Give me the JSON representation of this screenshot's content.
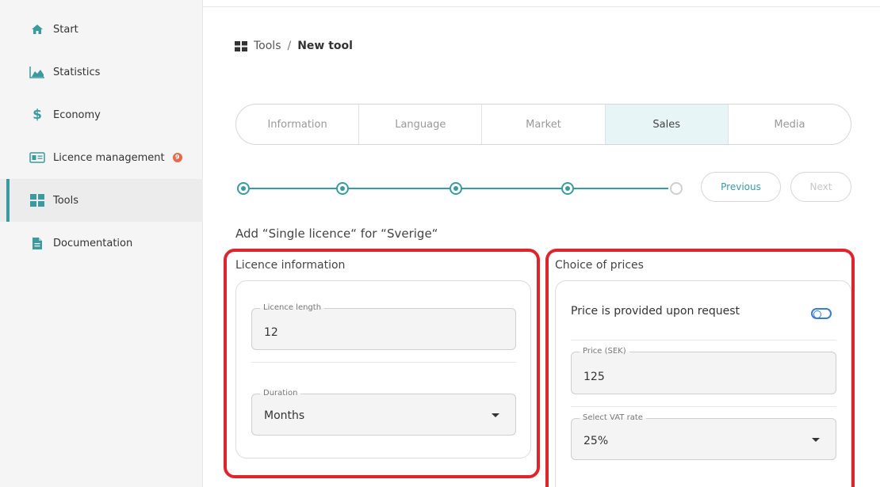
{
  "sidebar": {
    "items": [
      {
        "label": "Start",
        "icon": "home-icon"
      },
      {
        "label": "Statistics",
        "icon": "area-chart-icon"
      },
      {
        "label": "Economy",
        "icon": "dollar-icon"
      },
      {
        "label": "Licence management",
        "icon": "id-card-icon",
        "badge": "9"
      },
      {
        "label": "Tools",
        "icon": "grid-icon"
      },
      {
        "label": "Documentation",
        "icon": "document-icon"
      }
    ],
    "active": "Tools"
  },
  "breadcrumb": {
    "root": "Tools",
    "separator": "/",
    "current": "New tool"
  },
  "tabs": [
    "Information",
    "Language",
    "Market",
    "Sales",
    "Media"
  ],
  "active_tab": "Sales",
  "stepper": {
    "total_steps": 5,
    "completed_steps": 4
  },
  "buttons": {
    "previous": "Previous",
    "next": "Next"
  },
  "heading": "Add “Single licence“ for “Sverige“",
  "licence_info": {
    "title": "Licence information",
    "length_label": "Licence length",
    "length_value": "12",
    "duration_label": "Duration",
    "duration_value": "Months"
  },
  "prices": {
    "title": "Choice of prices",
    "on_request_label": "Price is provided upon request",
    "price_label": "Price (SEK)",
    "price_value": "125",
    "vat_label": "Select VAT rate",
    "vat_value": "25%"
  },
  "colors": {
    "accent": "#3a9aa0",
    "highlight": "#e0242c",
    "badge": "#e8694a",
    "toggle": "#3a7bd5"
  }
}
